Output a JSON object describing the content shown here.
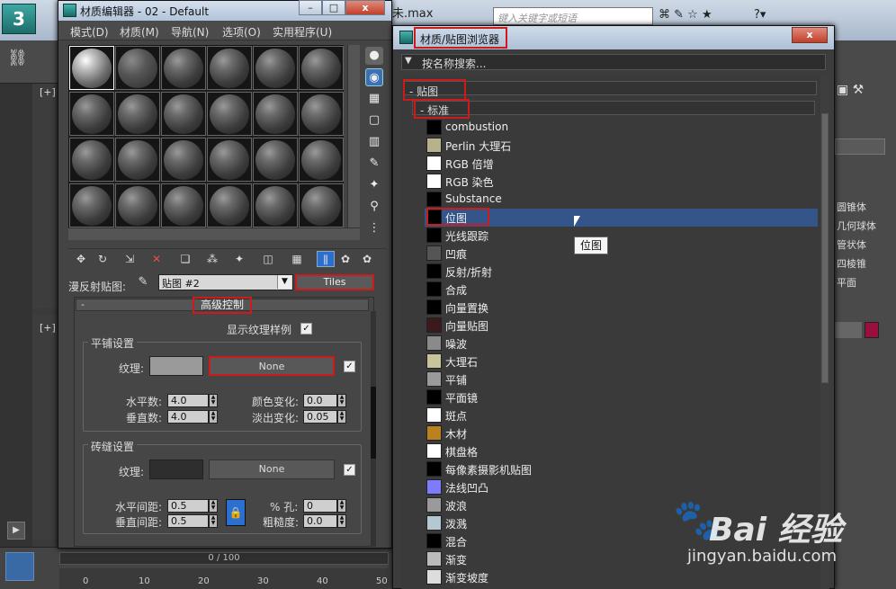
{
  "app": {
    "file_title": "未.max",
    "search_placeholder": "键入关键字或短语",
    "viewport_label_a": "[+]",
    "viewport_label_b": "[+]",
    "timeline_value": "0 / 100",
    "timeline_ticks": [
      "0",
      "10",
      "20",
      "30",
      "40",
      "50"
    ],
    "right_panel_items": [
      "圆锥体",
      "几何球体",
      "管状体",
      "四棱锥",
      "平面"
    ],
    "right_swatch_color": "#9a0f3c"
  },
  "material_editor": {
    "title": "材质编辑器 - 02 - Default",
    "menus": [
      "模式(D)",
      "材质(M)",
      "导航(N)",
      "选项(O)",
      "实用程序(U)"
    ],
    "map_label": "漫反射贴图:",
    "map_select": "贴图 #2",
    "map_type_button": "Tiles",
    "rollout_title": "高级控制",
    "rollout_minus": "-",
    "show_texture_sample": "显示纹理样例",
    "tiling_group": {
      "title": "平铺设置",
      "texture_label": "纹理:",
      "texture_map": "None",
      "horiz_count_label": "水平数:",
      "horiz_count": "4.0",
      "vert_count_label": "垂直数:",
      "vert_count": "4.0",
      "color_var_label": "颜色变化:",
      "color_var": "0.0",
      "fade_var_label": "淡出变化:",
      "fade_var": "0.05"
    },
    "grout_group": {
      "title": "砖缝设置",
      "texture_label": "纹理:",
      "texture_map": "None",
      "horiz_gap_label": "水平间距:",
      "horiz_gap": "0.5",
      "vert_gap_label": "垂直间距:",
      "vert_gap": "0.5",
      "holes_label": "% 孔:",
      "holes": "0",
      "rough_label": "粗糙度:",
      "rough": "0.0"
    }
  },
  "browser": {
    "title": "材质/贴图浏览器",
    "close": "x",
    "search_placeholder": "按名称搜索...",
    "category": "- 贴图",
    "subcategory": "- 标准",
    "items": [
      {
        "label": "combustion",
        "icon": "#000000"
      },
      {
        "label": "Perlin 大理石",
        "icon": "#b7b28c"
      },
      {
        "label": "RGB 倍增",
        "icon": "#ffffff"
      },
      {
        "label": "RGB 染色",
        "icon": "#ffffff"
      },
      {
        "label": "Substance",
        "icon": "#000000"
      },
      {
        "label": "位图",
        "icon": "#000000"
      },
      {
        "label": "光线跟踪",
        "icon": "#000000"
      },
      {
        "label": "凹痕",
        "icon": "#555555"
      },
      {
        "label": "反射/折射",
        "icon": "#000000"
      },
      {
        "label": "合成",
        "icon": "#000000"
      },
      {
        "label": "向量置换",
        "icon": "#000000"
      },
      {
        "label": "向量贴图",
        "icon": "#3a1a1a"
      },
      {
        "label": "噪波",
        "icon": "#8a8a8a"
      },
      {
        "label": "大理石",
        "icon": "#c8c39a"
      },
      {
        "label": "平铺",
        "icon": "#9a9a9a"
      },
      {
        "label": "平面镜",
        "icon": "#000000"
      },
      {
        "label": "斑点",
        "icon": "#ffffff"
      },
      {
        "label": "木材",
        "icon": "#b9821f"
      },
      {
        "label": "棋盘格",
        "icon": "#ffffff"
      },
      {
        "label": "每像素摄影机贴图",
        "icon": "#000000"
      },
      {
        "label": "法线凹凸",
        "icon": "#7d7cff"
      },
      {
        "label": "波浪",
        "icon": "#9a9a9a"
      },
      {
        "label": "泼溅",
        "icon": "#b4c8d2"
      },
      {
        "label": "混合",
        "icon": "#000000"
      },
      {
        "label": "渐变",
        "icon": "#bbbbbb"
      },
      {
        "label": "渐变坡度",
        "icon": "#dddddd"
      }
    ],
    "selected_index": 5,
    "tooltip": "位图"
  },
  "watermark": {
    "brand": "Bai 经验",
    "url": "jingyan.baidu.com"
  }
}
